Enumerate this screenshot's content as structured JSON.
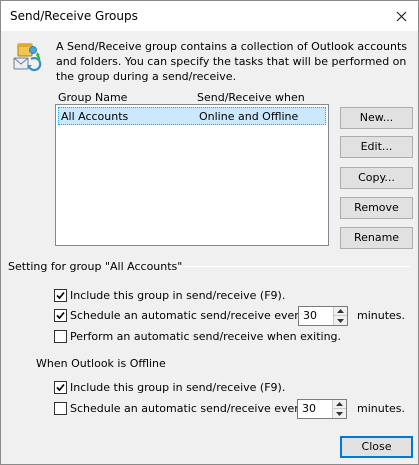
{
  "window": {
    "title": "Send/Receive Groups",
    "close_glyph": "✕"
  },
  "intro": {
    "icon": "send-receive-groups-icon",
    "text": "A Send/Receive group contains a collection of Outlook accounts and folders. You can specify the tasks that will be performed on the group during a send/receive."
  },
  "groups_list": {
    "columns": [
      "Group Name",
      "Send/Receive when"
    ],
    "rows": [
      {
        "name": "All Accounts",
        "when": "Online and Offline",
        "selected": true
      }
    ]
  },
  "buttons": {
    "new": "New...",
    "edit": "Edit...",
    "copy": "Copy...",
    "remove": "Remove",
    "rename": "Rename",
    "close": "Close"
  },
  "online_settings": {
    "heading": "Setting for group \"All Accounts\"",
    "include": {
      "label": "Include this group in send/receive (F9).",
      "checked": true
    },
    "schedule": {
      "label": "Schedule an automatic send/receive every",
      "checked": true,
      "value": "30",
      "unit": "minutes."
    },
    "on_exit": {
      "label": "Perform an automatic send/receive when exiting.",
      "checked": false
    }
  },
  "offline_settings": {
    "heading": "When Outlook is Offline",
    "include": {
      "label": "Include this group in send/receive (F9).",
      "checked": true
    },
    "schedule": {
      "label": "Schedule an automatic send/receive every",
      "checked": false,
      "value": "30",
      "unit": "minutes."
    }
  },
  "colors": {
    "selection_bg": "#cce8ff",
    "selection_border": "#26a0da",
    "focus_border": "#0078d7"
  }
}
